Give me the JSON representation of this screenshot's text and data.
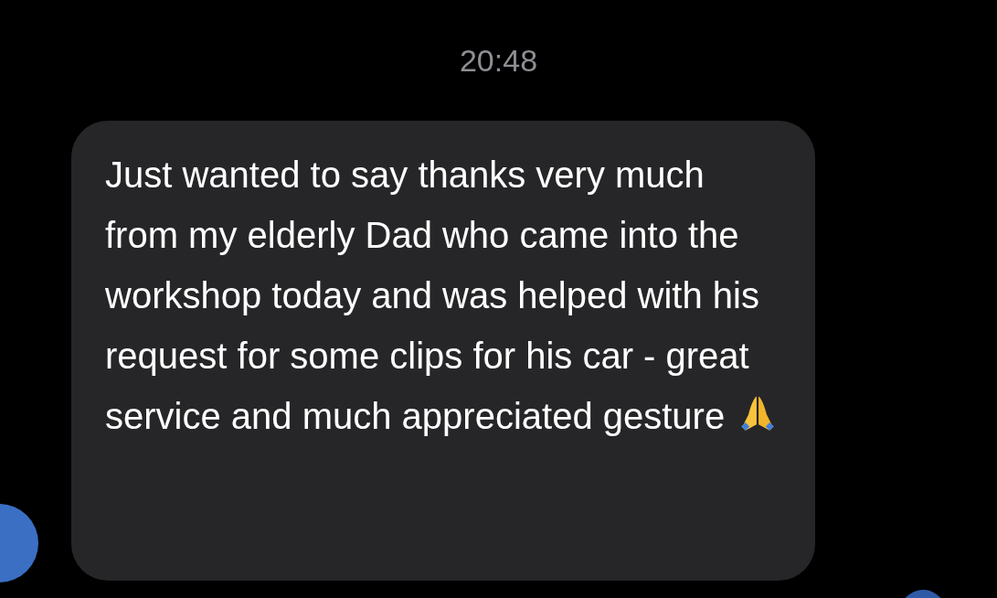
{
  "timestamp": "20:48",
  "message": {
    "text": "Just wanted to say thanks very much from my elderly Dad who came into the workshop today and was helped with his request for some clips for his car - great service and much appreciated gesture"
  }
}
